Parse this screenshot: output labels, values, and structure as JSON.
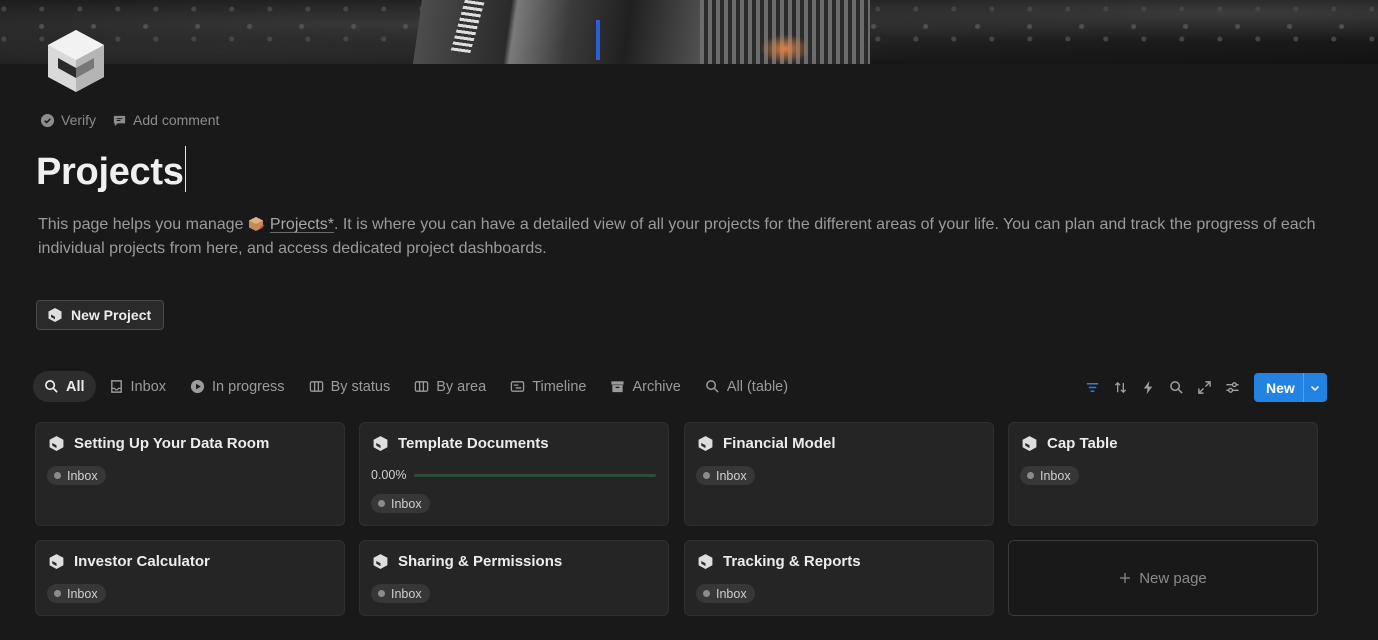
{
  "header": {
    "verify_label": "Verify",
    "add_comment_label": "Add comment",
    "title": "Projects"
  },
  "description": {
    "before": "This page helps you manage ",
    "link": "Projects*",
    "after": ". It is where you can have a detailed view of all your projects for the different areas of your life. You can plan and track the progress of each individual projects from here, and access dedicated project dashboards."
  },
  "new_project_label": "New Project",
  "tabs": [
    {
      "label": "All",
      "icon": "search-icon",
      "active": true
    },
    {
      "label": "Inbox",
      "icon": "inbox-icon"
    },
    {
      "label": "In progress",
      "icon": "play-icon"
    },
    {
      "label": "By status",
      "icon": "board-icon"
    },
    {
      "label": "By area",
      "icon": "board-icon"
    },
    {
      "label": "Timeline",
      "icon": "timeline-icon"
    },
    {
      "label": "Archive",
      "icon": "archive-icon"
    },
    {
      "label": "All (table)",
      "icon": "search-icon"
    }
  ],
  "toolbar": {
    "new_label": "New",
    "accent": "#2383e2",
    "icons": [
      "filter-icon",
      "sort-icon",
      "automation-icon",
      "search-icon",
      "expand-icon",
      "settings-icon"
    ]
  },
  "cards": [
    {
      "title": "Setting Up Your Data Room",
      "status": "Inbox"
    },
    {
      "title": "Template Documents",
      "progress": "0.00%",
      "status": "Inbox"
    },
    {
      "title": "Financial Model",
      "status": "Inbox"
    },
    {
      "title": "Cap Table",
      "status": "Inbox"
    },
    {
      "title": "Investor Calculator",
      "status": "Inbox"
    },
    {
      "title": "Sharing & Permissions",
      "status": "Inbox"
    },
    {
      "title": "Tracking & Reports",
      "status": "Inbox"
    }
  ],
  "new_page_label": "New page"
}
